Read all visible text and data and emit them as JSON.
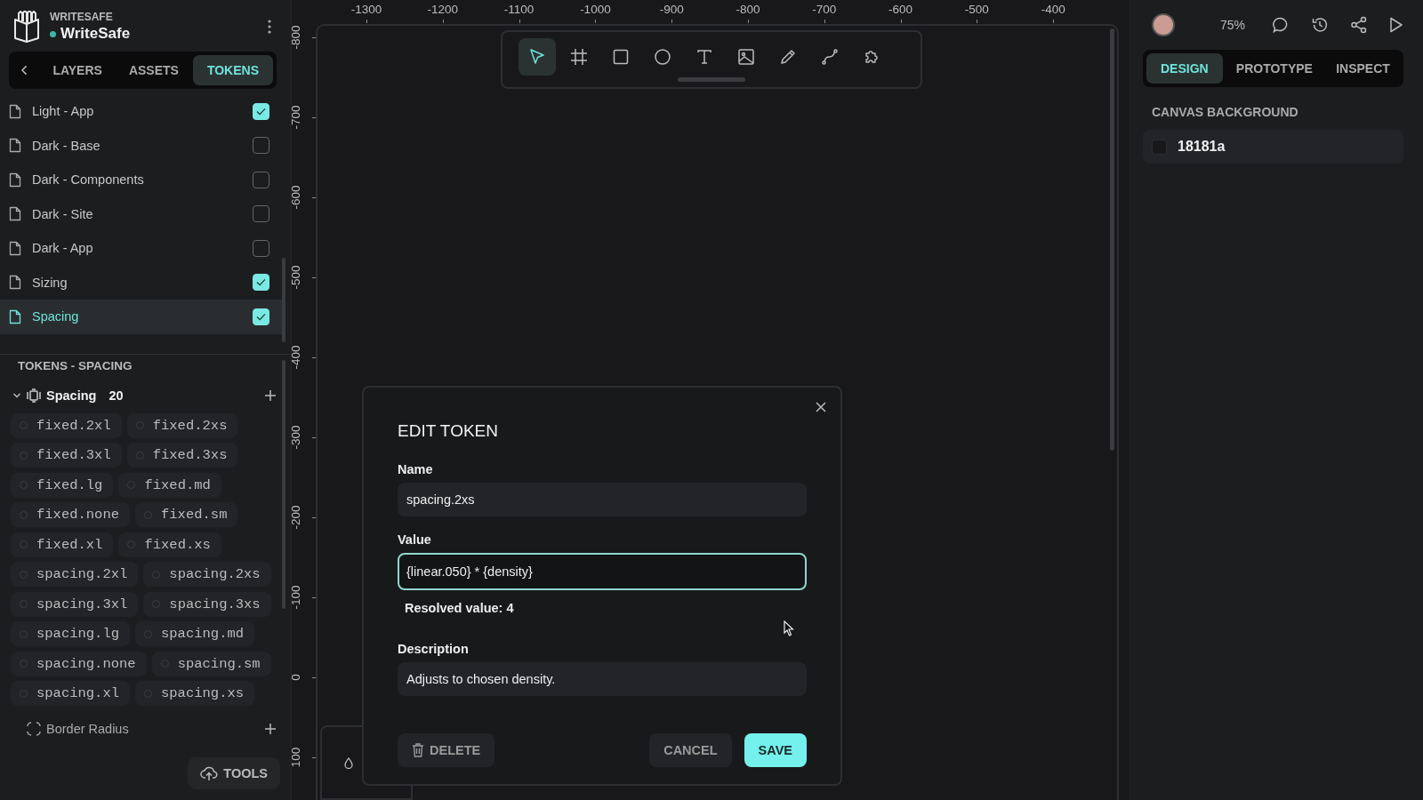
{
  "app": {
    "org": "WRITESAFE",
    "name": "WriteSafe"
  },
  "sidebar_tabs": [
    {
      "label": "LAYERS",
      "selected": false
    },
    {
      "label": "ASSETS",
      "selected": false
    },
    {
      "label": "TOKENS",
      "selected": true
    }
  ],
  "token_sets": [
    {
      "name": "Light - App",
      "checked": true,
      "selected": false
    },
    {
      "name": "Dark - Base",
      "checked": false,
      "selected": false
    },
    {
      "name": "Dark - Components",
      "checked": false,
      "selected": false
    },
    {
      "name": "Dark - Site",
      "checked": false,
      "selected": false
    },
    {
      "name": "Dark - App",
      "checked": false,
      "selected": false
    },
    {
      "name": "Sizing",
      "checked": true,
      "selected": false
    },
    {
      "name": "Spacing",
      "checked": true,
      "selected": true
    }
  ],
  "tokens_section": {
    "title": "TOKENS - SPACING",
    "groups": [
      {
        "kind": "spacing",
        "name": "Spacing",
        "count": "20",
        "expanded": true,
        "tokens": [
          "fixed.2xl",
          "fixed.2xs",
          "fixed.3xl",
          "fixed.3xs",
          "fixed.lg",
          "fixed.md",
          "fixed.none",
          "fixed.sm",
          "fixed.xl",
          "fixed.xs",
          "spacing.2xl",
          "spacing.2xs",
          "spacing.3xl",
          "spacing.3xs",
          "spacing.lg",
          "spacing.md",
          "spacing.none",
          "spacing.sm",
          "spacing.xl",
          "spacing.xs"
        ]
      },
      {
        "kind": "radius",
        "name": "Border Radius",
        "expanded": false
      }
    ]
  },
  "tools_button": "TOOLS",
  "ruler": {
    "x_labels": [
      "-1300",
      "-1200",
      "-1100",
      "-1000",
      "-900",
      "-800",
      "-700",
      "-600",
      "-500",
      "-400"
    ],
    "y_labels": [
      "-800",
      "-700",
      "-600",
      "-500",
      "-400",
      "-300",
      "-200",
      "-100",
      "0",
      "100"
    ]
  },
  "toolbar": [
    {
      "kind": "pointer",
      "selected": true
    },
    {
      "kind": "frame",
      "selected": false
    },
    {
      "kind": "rectangle",
      "selected": false
    },
    {
      "kind": "ellipse",
      "selected": false
    },
    {
      "kind": "text",
      "selected": false
    },
    {
      "kind": "image",
      "selected": false
    },
    {
      "kind": "pencil",
      "selected": false
    },
    {
      "kind": "path",
      "selected": false
    },
    {
      "kind": "plugin",
      "selected": false
    }
  ],
  "zoom": "75%",
  "right_tabs": [
    {
      "label": "DESIGN",
      "selected": true
    },
    {
      "label": "PROTOTYPE",
      "selected": false
    },
    {
      "label": "INSPECT",
      "selected": false
    }
  ],
  "canvas_background": {
    "title": "CANVAS BACKGROUND",
    "value": "18181a"
  },
  "dialog": {
    "title": "EDIT TOKEN",
    "fields": [
      {
        "label": "Name",
        "value": "spacing.2xs",
        "focused": false
      },
      {
        "label": "Value",
        "value": "{linear.050} * {density}",
        "focused": true,
        "hint": "Resolved value: 4"
      },
      {
        "label": "Description",
        "value": "Adjusts to chosen density.",
        "focused": false
      }
    ],
    "delete": "DELETE",
    "cancel": "CANCEL",
    "save": "SAVE"
  }
}
